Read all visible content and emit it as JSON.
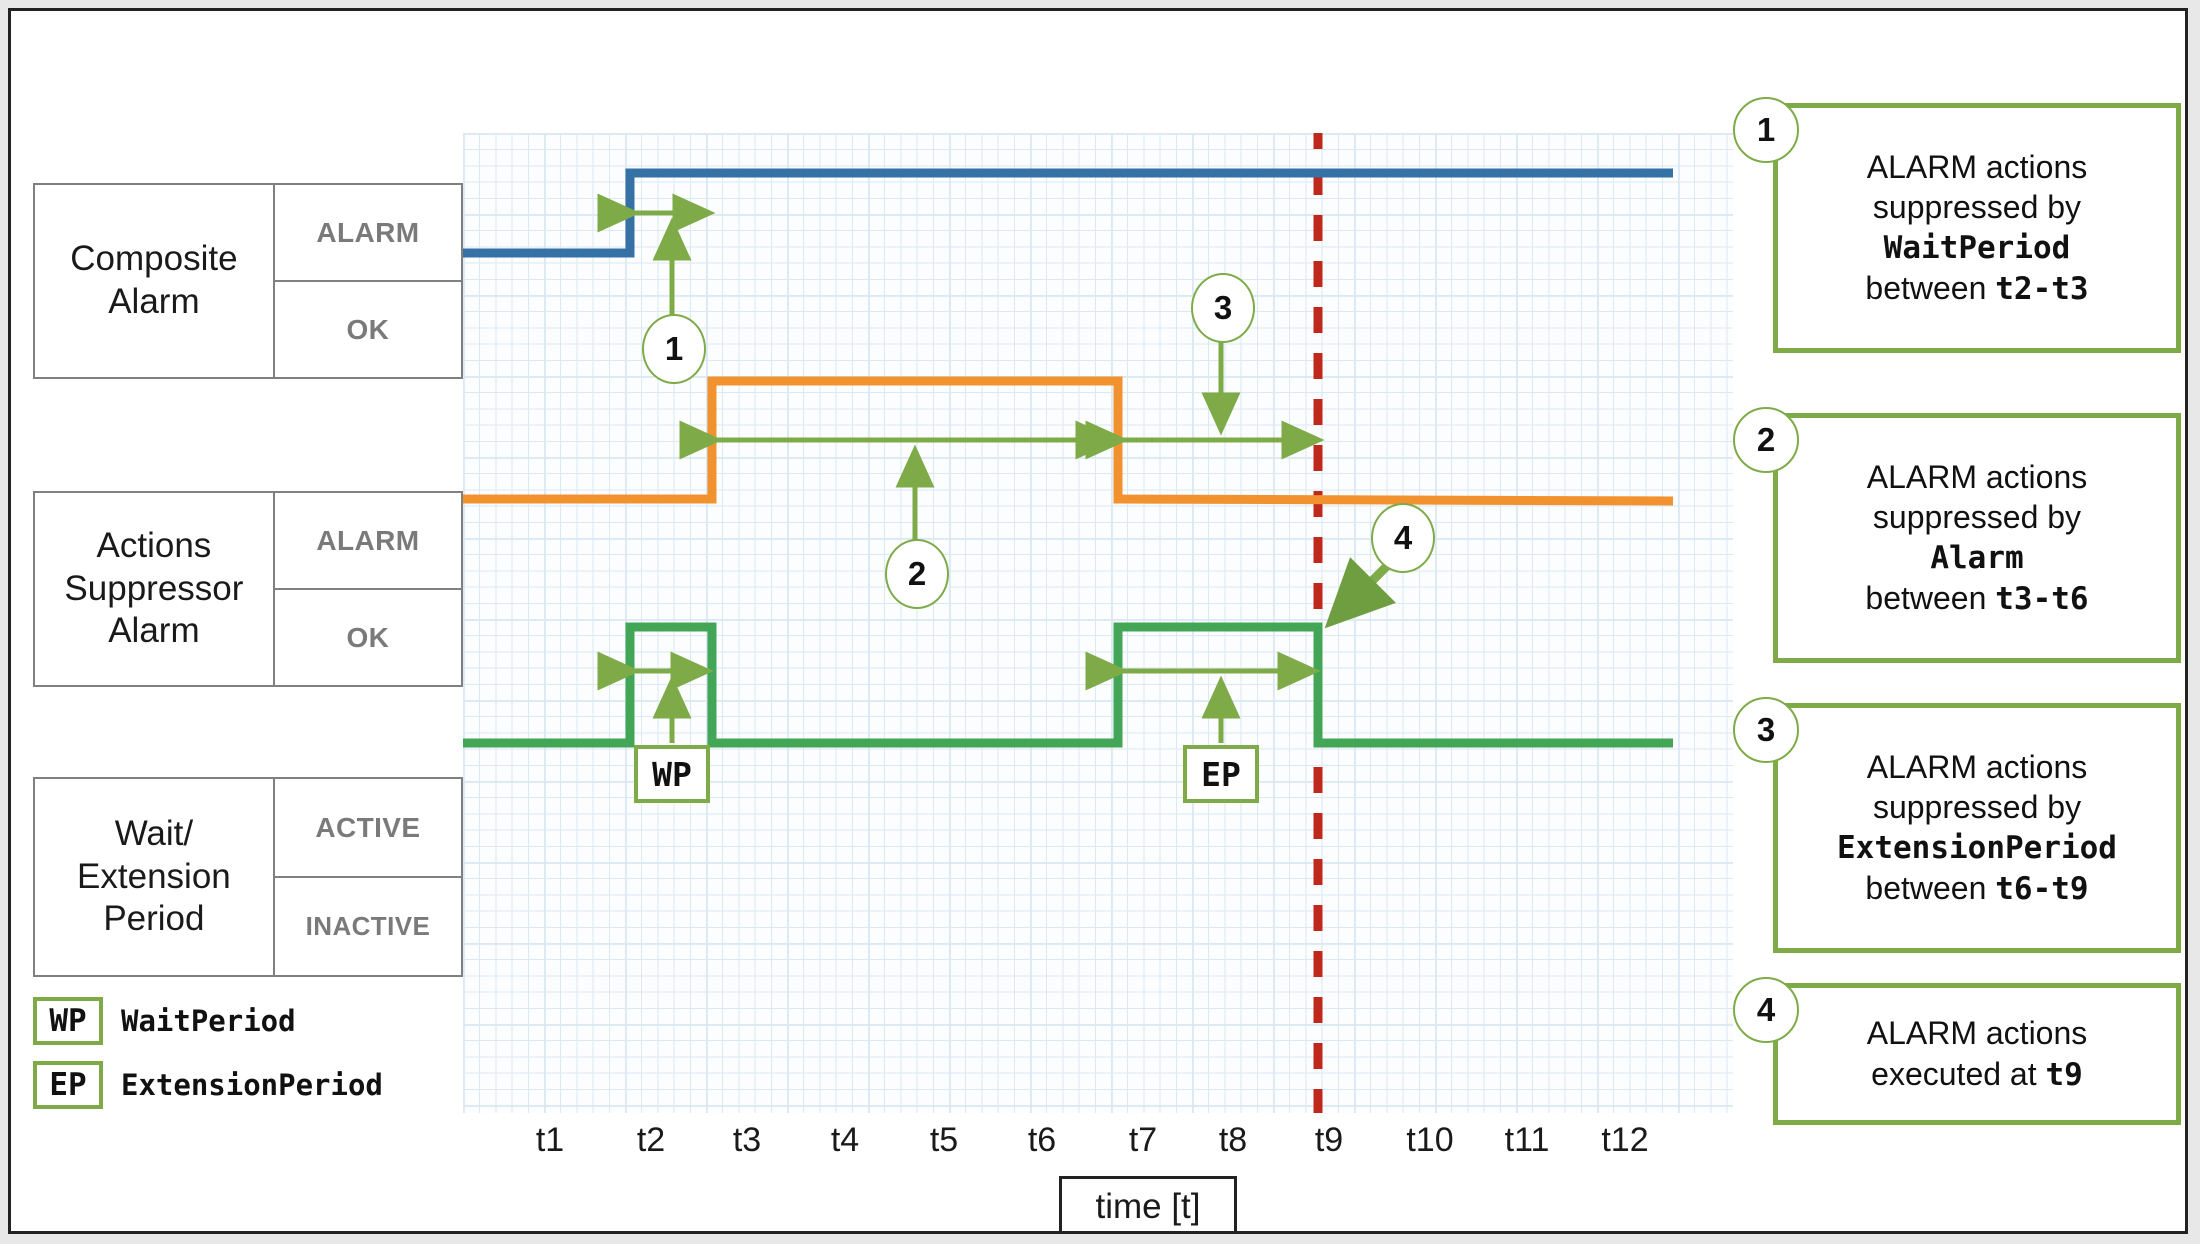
{
  "rows": [
    {
      "name": "Composite\nAlarm",
      "name_l1": "Composite",
      "name_l2": "Alarm",
      "state_high": "ALARM",
      "state_low": "OK"
    },
    {
      "name": "Actions Suppressor Alarm",
      "name_l1": "Actions",
      "name_l2": "Suppressor",
      "name_l3": "Alarm",
      "state_high": "ALARM",
      "state_low": "OK"
    },
    {
      "name": "Wait/ Extension Period",
      "name_l1": "Wait/",
      "name_l2": "Extension",
      "name_l3": "Period",
      "state_high": "ACTIVE",
      "state_low": "INACTIVE"
    }
  ],
  "legend": [
    {
      "abbr": "WP",
      "label": "WaitPeriod"
    },
    {
      "abbr": "EP",
      "label": "ExtensionPeriod"
    }
  ],
  "axis": {
    "caption": "time [t]",
    "ticks": [
      "t1",
      "t2",
      "t3",
      "t4",
      "t5",
      "t6",
      "t7",
      "t8",
      "t9",
      "t10",
      "t11",
      "t12"
    ]
  },
  "plot_markers": {
    "bubble_1": "1",
    "bubble_2": "2",
    "bubble_3": "3",
    "bubble_4": "4",
    "chip_wp": "WP",
    "chip_ep": "EP"
  },
  "callouts": [
    {
      "num": "1",
      "line1": "ALARM actions",
      "line2": "suppressed by",
      "term": "WaitPeriod",
      "line4_pre": "between ",
      "line4_mono": "t2-t3"
    },
    {
      "num": "2",
      "line1": "ALARM actions",
      "line2": "suppressed by",
      "term": "Alarm",
      "line4_pre": "between ",
      "line4_mono": "t3-t6"
    },
    {
      "num": "3",
      "line1": "ALARM actions",
      "line2": "suppressed by",
      "term": "ExtensionPeriod",
      "line4_pre": "between ",
      "line4_mono": "t6-t9"
    },
    {
      "num": "4",
      "line1": "ALARM actions",
      "line2_pre": "executed at ",
      "line2_mono": "t9"
    }
  ],
  "colors": {
    "composite_alarm": "#3571A5",
    "actions_suppressor": "#F2922E",
    "wait_extension": "#43A657",
    "callout_green": "#7eab48",
    "event_marker_red": "#C0281C",
    "grid_minor": "#dce9f3",
    "grid_major": "#c3dcec"
  },
  "chart_data": {
    "type": "line",
    "title": "",
    "xlabel": "time [t]",
    "x_ticks": [
      "t1",
      "t2",
      "t3",
      "t4",
      "t5",
      "t6",
      "t7",
      "t8",
      "t9",
      "t10",
      "t11",
      "t12"
    ],
    "event_marker": {
      "label": "t9",
      "style": "dashed-vertical",
      "color": "#C0281C"
    },
    "series": [
      {
        "name": "Composite Alarm",
        "color": "#3571A5",
        "states": [
          "OK",
          "ALARM"
        ],
        "steps": [
          {
            "x": "t0",
            "state": "OK"
          },
          {
            "x": "t2",
            "state": "ALARM"
          },
          {
            "x": "t12",
            "state": "ALARM"
          }
        ]
      },
      {
        "name": "Actions Suppressor Alarm",
        "color": "#F2922E",
        "states": [
          "OK",
          "ALARM"
        ],
        "steps": [
          {
            "x": "t0",
            "state": "OK"
          },
          {
            "x": "t3",
            "state": "ALARM"
          },
          {
            "x": "t6",
            "state": "OK"
          },
          {
            "x": "t12",
            "state": "OK"
          }
        ]
      },
      {
        "name": "Wait/Extension Period",
        "color": "#43A657",
        "states": [
          "INACTIVE",
          "ACTIVE"
        ],
        "steps": [
          {
            "x": "t0",
            "state": "INACTIVE"
          },
          {
            "x": "t2",
            "state": "ACTIVE"
          },
          {
            "x": "t4",
            "state": "INACTIVE"
          },
          {
            "x": "t6",
            "state": "ACTIVE"
          },
          {
            "x": "t9",
            "state": "INACTIVE"
          },
          {
            "x": "t12",
            "state": "INACTIVE"
          }
        ]
      }
    ],
    "spans": [
      {
        "id": "1",
        "from": "t2",
        "to": "t3",
        "label": "WaitPeriod",
        "row": "Composite Alarm"
      },
      {
        "id": "2",
        "from": "t3",
        "to": "t6",
        "label": "Alarm",
        "row": "Actions Suppressor Alarm"
      },
      {
        "id": "3",
        "from": "t6",
        "to": "t9",
        "label": "ExtensionPeriod",
        "row": "Actions Suppressor Alarm"
      },
      {
        "id": "wp",
        "from": "t2",
        "to": "t4",
        "label": "WP",
        "row": "Wait/Extension Period"
      },
      {
        "id": "ep",
        "from": "t6",
        "to": "t9",
        "label": "EP",
        "row": "Wait/Extension Period"
      }
    ]
  }
}
